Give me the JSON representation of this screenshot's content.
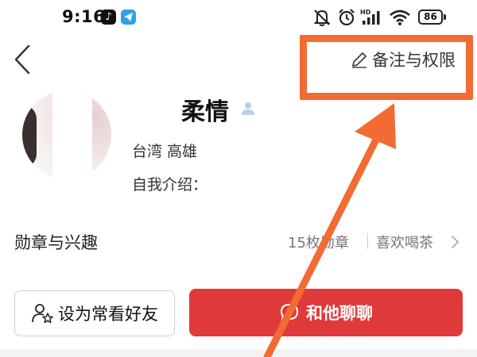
{
  "status_bar": {
    "time": "9:16",
    "tiktok_glyph": "♪",
    "battery": "86",
    "icons": [
      "tiktok-icon",
      "telegram-icon",
      "mute-icon",
      "alarm-icon",
      "signal-icon",
      "wifi-icon",
      "battery-icon"
    ]
  },
  "nav": {
    "back_icon": "chevron-left-icon",
    "remark_label": "备注与权限",
    "remark_icon": "pencil-icon"
  },
  "profile": {
    "name": "柔情",
    "location": "台湾 高雄",
    "intro": "自我介绍："
  },
  "badges_row": {
    "title": "勋章与兴趣",
    "badge_count": "15枚勋章",
    "interest": "喜欢喝茶"
  },
  "actions": {
    "friend_label": "设为常看好友",
    "chat_label": "和他聊聊"
  },
  "colors": {
    "accent_red": "#e0393b",
    "annotation_orange": "#f26b33",
    "telegram_blue": "#2aa3e8"
  }
}
